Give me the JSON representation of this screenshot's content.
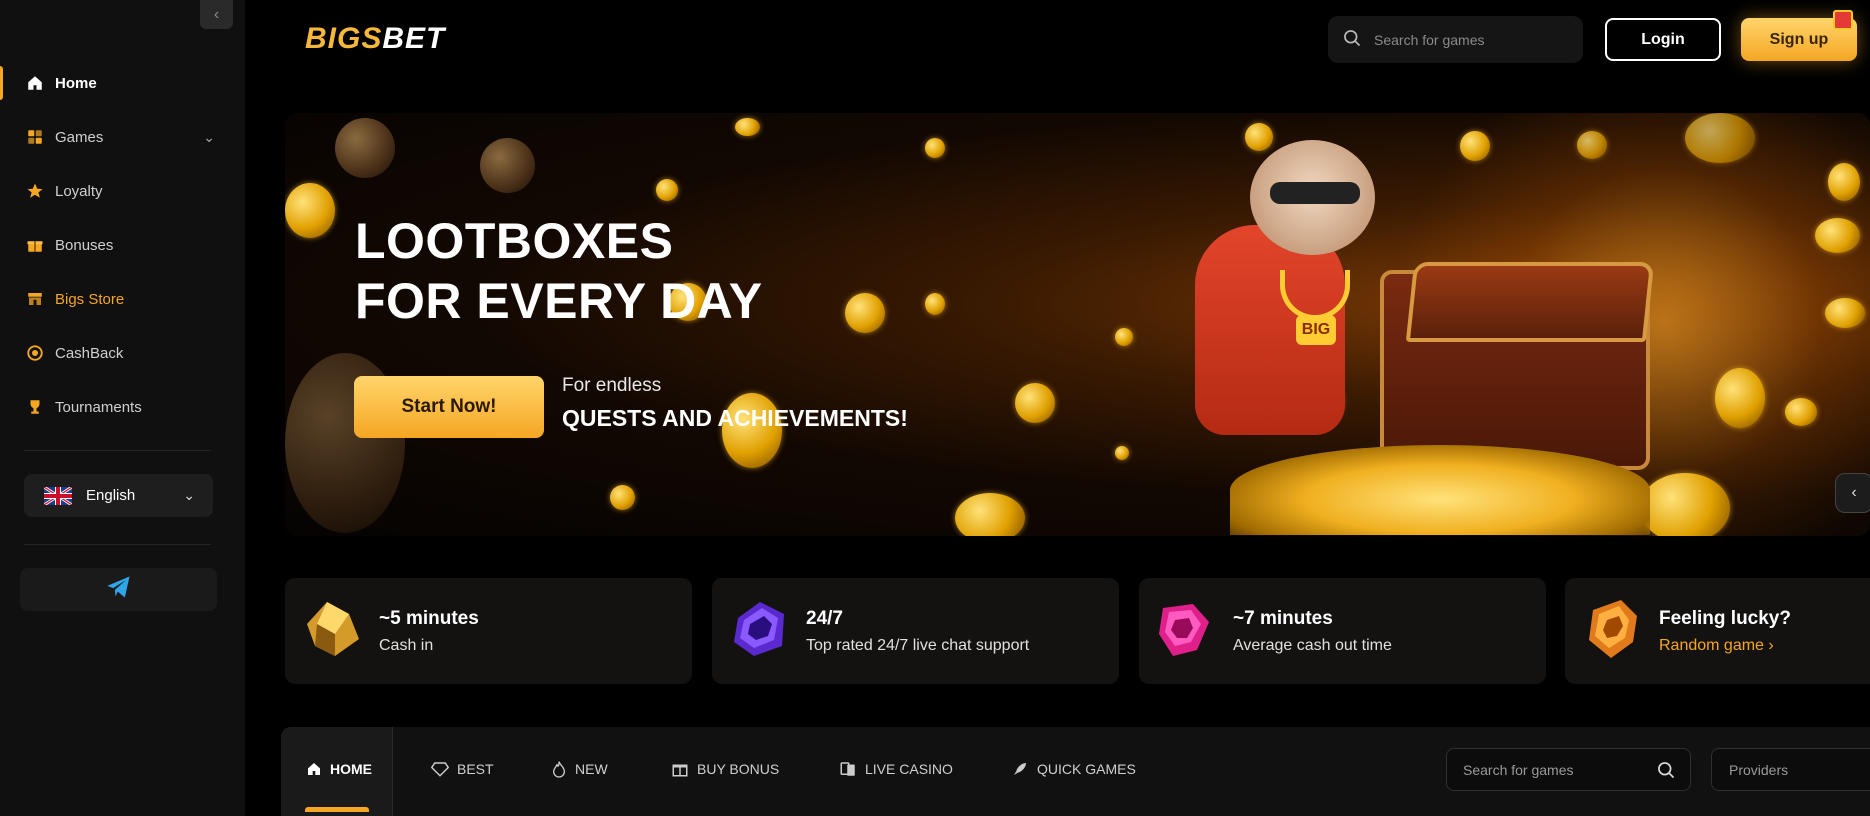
{
  "brand": {
    "logo_left": "BIGS",
    "logo_right": "BET"
  },
  "sidebar": {
    "items": [
      {
        "label": "Home",
        "icon": "home-icon"
      },
      {
        "label": "Games",
        "icon": "games-icon"
      },
      {
        "label": "Loyalty",
        "icon": "star-icon"
      },
      {
        "label": "Bonuses",
        "icon": "gift-icon"
      },
      {
        "label": "Bigs Store",
        "icon": "store-icon"
      },
      {
        "label": "CashBack",
        "icon": "cashback-icon"
      },
      {
        "label": "Tournaments",
        "icon": "trophy-icon"
      }
    ],
    "language": "English"
  },
  "header": {
    "search_placeholder": "Search for games",
    "login_label": "Login",
    "signup_label": "Sign up"
  },
  "hero": {
    "title_line1": "LOOTBOXES",
    "title_line2": "FOR EVERY DAY",
    "cta_label": "Start Now!",
    "sub_line1": "For endless",
    "sub_line2": "QUESTS AND ACHIEVEMENTS!",
    "medallion_text": "BIG"
  },
  "features": [
    {
      "title": "~5 minutes",
      "subtitle": "Cash in"
    },
    {
      "title": "24/7",
      "subtitle": "Top rated 24/7 live chat support"
    },
    {
      "title": "~7 minutes",
      "subtitle": "Average cash out time"
    },
    {
      "title": "Feeling lucky?",
      "subtitle": "Random game ›"
    }
  ],
  "game_tabs": [
    {
      "label": "HOME",
      "icon": "home-icon"
    },
    {
      "label": "BEST",
      "icon": "diamond-icon"
    },
    {
      "label": "NEW",
      "icon": "fire-icon"
    },
    {
      "label": "BUY BONUS",
      "icon": "gift-icon"
    },
    {
      "label": "LIVE CASINO",
      "icon": "cards-icon"
    },
    {
      "label": "QUICK GAMES",
      "icon": "rocket-icon"
    }
  ],
  "game_filters": {
    "search_placeholder": "Search for games",
    "providers_label": "Providers"
  },
  "colors": {
    "accent": "#f5a623",
    "sidebar_bg": "#101010",
    "page_bg": "#000000"
  }
}
